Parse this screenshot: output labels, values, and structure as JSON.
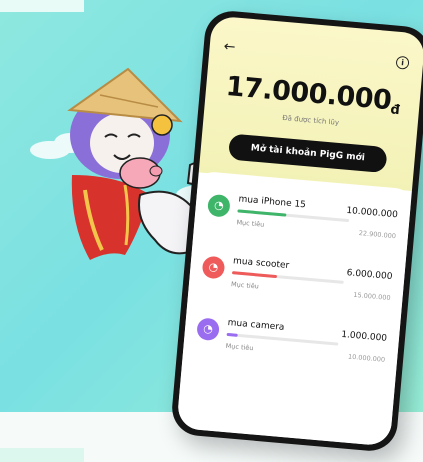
{
  "colors": {
    "background": "#8ee8df",
    "balance_panel": "#fbf7c9",
    "button": "#111111"
  },
  "screen": {
    "back_icon": "back-arrow-icon",
    "info_icon": "info-icon",
    "balance": "17.000.000",
    "currency": "đ",
    "saved_label": "Đã được tích lũy",
    "open_account_button": "Mở tài khoản PigG mới"
  },
  "goals": [
    {
      "name": "mua iPhone 15",
      "amount": "10.000.000",
      "target_label": "Mục tiêu",
      "target": "22.900.000",
      "progress": 0.44,
      "color": "#3fb56a",
      "icon": "piggy-icon"
    },
    {
      "name": "mua scooter",
      "amount": "6.000.000",
      "target_label": "Mục tiêu",
      "target": "15.000.000",
      "progress": 0.4,
      "color": "#ef5a5a",
      "icon": "piggy-icon"
    },
    {
      "name": "mua camera",
      "amount": "1.000.000",
      "target_label": "Mục tiêu",
      "target": "10.000.000",
      "progress": 0.1,
      "color": "#9a6cf0",
      "icon": "piggy-icon"
    }
  ]
}
